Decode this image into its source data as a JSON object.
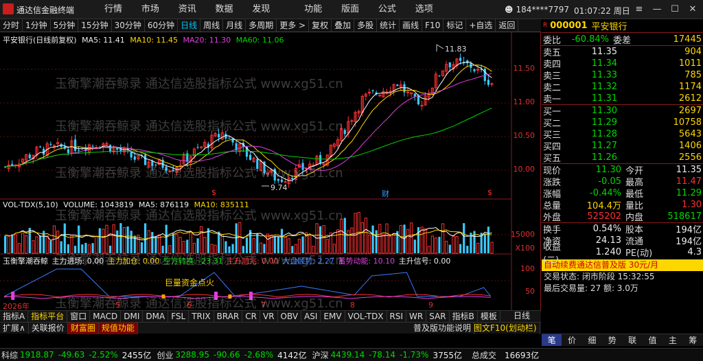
{
  "app": {
    "title": "通达信金融终端"
  },
  "menus": [
    "行情",
    "市场",
    "资讯",
    "数据",
    "发现",
    "功能",
    "版面",
    "公式",
    "选项"
  ],
  "user": "184****7797",
  "clock": "01:07:22 周日",
  "toolbar": [
    "分时",
    "1分钟",
    "5分钟",
    "15分钟",
    "30分钟",
    "60分钟",
    "日线",
    "周线",
    "月线",
    "多周期",
    "更多 >",
    "复权",
    "叠加",
    "多股",
    "统计",
    "画线",
    "F10",
    "标记",
    "+自选",
    "返回"
  ],
  "chart": {
    "header": {
      "name": "平安银行(日线前复权)",
      "ma5": "MA5: 11.41",
      "ma10": "MA10: 11.45",
      "ma20": "MA20: 11.30",
      "ma60": "MA60: 11.06"
    },
    "price_labels": [
      "11.50",
      "11.00",
      "10.50",
      "10.00"
    ],
    "hi_label": "11.83",
    "lo_label": "9.74",
    "fin_mark": "财",
    "vol_header": {
      "name": "VOL-TDX(5,10)",
      "vol": "VOLUME: 1043819",
      "ma5": "MA5: 876119",
      "ma10": "MA10: 835111"
    },
    "vol_label": "15000",
    "vol_unit": "X100",
    "ind_header": {
      "name": "玉衡擎潮吞鲸",
      "a": "主力进场: 0.00",
      "b": "主力加仓: 0.00",
      "c": "空方转换: -23.31",
      "d": "主升前兆: 0.00",
      "e": "大盘顺势: 2.27",
      "f": "蓄势动能: 10.10",
      "g": "主升信号: 0.00"
    },
    "ind_note": "巨量资金点火",
    "ind_labels": [
      "100",
      "50"
    ],
    "dates": [
      "2026年",
      "5",
      "6",
      "7",
      "8",
      "9"
    ]
  },
  "quote": {
    "code": "000001",
    "name": "平安银行",
    "ratio": {
      "label": "委比",
      "value": "-60.84%",
      "label2": "委差",
      "value2": "17445"
    },
    "asks": [
      {
        "l": "卖五",
        "p": "11.35",
        "v": "904"
      },
      {
        "l": "卖四",
        "p": "11.34",
        "v": "1011"
      },
      {
        "l": "卖三",
        "p": "11.33",
        "v": "785"
      },
      {
        "l": "卖二",
        "p": "11.32",
        "v": "1174"
      },
      {
        "l": "卖一",
        "p": "11.31",
        "v": "2612"
      }
    ],
    "bids": [
      {
        "l": "买一",
        "p": "11.30",
        "v": "2697"
      },
      {
        "l": "买二",
        "p": "11.29",
        "v": "10758"
      },
      {
        "l": "买三",
        "p": "11.28",
        "v": "5643"
      },
      {
        "l": "买四",
        "p": "11.27",
        "v": "1406"
      },
      {
        "l": "买五",
        "p": "11.26",
        "v": "2556"
      }
    ],
    "stats": [
      {
        "l1": "现价",
        "v1": "11.30",
        "c1": "g",
        "l2": "今开",
        "v2": "11.35",
        "c2": "w"
      },
      {
        "l1": "涨跌",
        "v1": "-0.05",
        "c1": "g",
        "l2": "最高",
        "v2": "11.47",
        "c2": "r"
      },
      {
        "l1": "涨幅",
        "v1": "-0.44%",
        "c1": "g",
        "l2": "最低",
        "v2": "11.29",
        "c2": "g"
      },
      {
        "l1": "总量",
        "v1": "104.4万",
        "c1": "y",
        "l2": "量比",
        "v2": "1.30",
        "c2": "r"
      },
      {
        "l1": "外盘",
        "v1": "525202",
        "c1": "r",
        "l2": "内盘",
        "v2": "518617",
        "c2": "g"
      }
    ],
    "stats2": [
      {
        "l1": "换手",
        "v1": "0.54%",
        "c1": "w",
        "l2": "股本",
        "v2": "194亿",
        "c2": "w"
      },
      {
        "l1": "净资",
        "v1": "24.13",
        "c1": "w",
        "l2": "流通",
        "v2": "194亿",
        "c2": "w"
      },
      {
        "l1": "收益(二)",
        "v1": "1.240",
        "c1": "w",
        "l2": "PE(动)",
        "v2": "4.3",
        "c2": "w"
      }
    ],
    "promo": "自动续费通达信普及版 30元/月",
    "trade_state": "交易状态: 闭市阶段   15:32:55",
    "last_trade": "最后交易量: 27  额: 3.0万",
    "side_tabs": [
      "笔",
      "价",
      "细",
      "势",
      "联",
      "值",
      "主",
      "筹"
    ]
  },
  "tabs1": [
    "指标A",
    "指标平台",
    "窗口",
    "MACD",
    "DMI",
    "DMA",
    "FSL",
    "TRIX",
    "BRAR",
    "CR",
    "VR",
    "OBV",
    "ASI",
    "EMV",
    "VOL-TDX",
    "RSI",
    "WR",
    "SAR",
    "指标B",
    "模板"
  ],
  "tabs2": [
    "扩展∧",
    "关联报价",
    "财富圈",
    "规值功能"
  ],
  "tabs2_right": [
    "普及版功能说明",
    "图文F10(划动栏)"
  ],
  "kline_label": "日线",
  "status": [
    {
      "name": "科综",
      "v": "1918.87",
      "c": "-49.63",
      "p": "-2.52%",
      "a": "2455亿"
    },
    {
      "name": "创业",
      "v": "3288.95",
      "c": "-90.66",
      "p": "-2.68%",
      "a": "4142亿"
    },
    {
      "name": "沪深",
      "v": "4439.14",
      "c": "-78.14",
      "p": "-1.73%",
      "a": "3755亿"
    }
  ],
  "status_total": {
    "l": "总成交",
    "v": "16693亿"
  },
  "watermark": "玉衡擎潮吞鲸录  通达信选股指标公式 www.xg51.cn"
}
